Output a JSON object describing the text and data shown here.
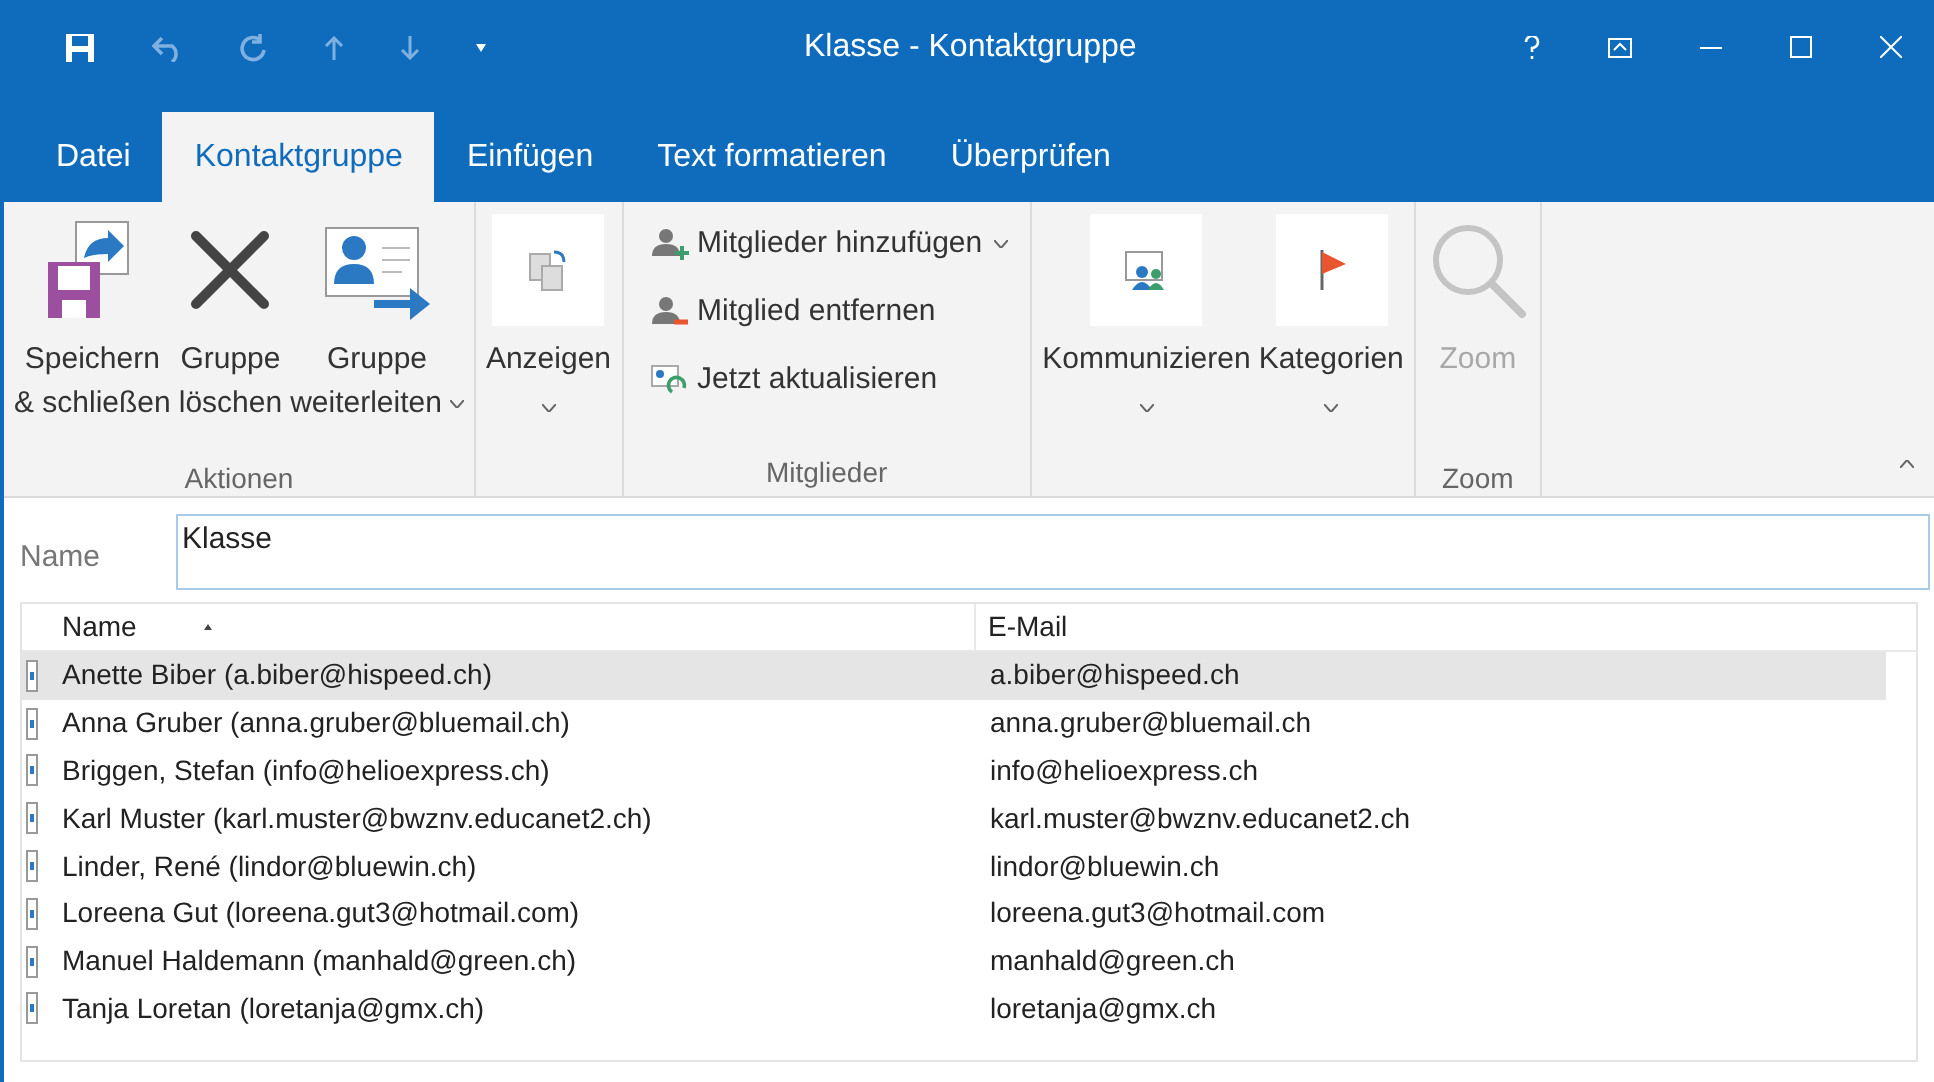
{
  "window": {
    "title": "Klasse - Kontaktgruppe"
  },
  "ribbon_tabs": [
    {
      "label": "Datei",
      "selected": false
    },
    {
      "label": "Kontaktgruppe",
      "selected": true
    },
    {
      "label": "Einfügen",
      "selected": false
    },
    {
      "label": "Text formatieren",
      "selected": false
    },
    {
      "label": "Überprüfen",
      "selected": false
    }
  ],
  "ribbon_groups": [
    {
      "label": "Aktionen",
      "items": [
        {
          "kind": "large",
          "lines": [
            "Speichern",
            "& schließen"
          ],
          "dropdown": false,
          "disabled": false
        },
        {
          "kind": "large",
          "lines": [
            "Gruppe",
            "löschen"
          ],
          "dropdown": false,
          "disabled": false
        },
        {
          "kind": "large",
          "lines": [
            "Gruppe",
            "weiterleiten"
          ],
          "dropdown": true,
          "disabled": false
        }
      ]
    },
    {
      "items": [
        {
          "kind": "large",
          "lines": [
            "Anzeigen"
          ],
          "dropdown": true,
          "disabled": false
        }
      ]
    },
    {
      "label": "Mitglieder",
      "items": [
        {
          "kind": "small",
          "lines": [
            "Mitglieder hinzufügen"
          ],
          "dropdown": true,
          "disabled": false
        },
        {
          "kind": "small",
          "lines": [
            "Mitglied entfernen"
          ],
          "dropdown": false,
          "disabled": false
        },
        {
          "kind": "small",
          "lines": [
            "Jetzt aktualisieren"
          ],
          "dropdown": false,
          "disabled": false
        }
      ]
    },
    {
      "items": [
        {
          "kind": "large",
          "lines": [
            "Kommunizieren"
          ],
          "dropdown": true,
          "disabled": false
        },
        {
          "kind": "large",
          "lines": [
            "Kategorien"
          ],
          "dropdown": true,
          "disabled": false
        }
      ]
    },
    {
      "label": "Zoom",
      "items": [
        {
          "kind": "large",
          "lines": [
            "Zoom"
          ],
          "dropdown": false,
          "disabled": true
        }
      ]
    }
  ],
  "name_field": {
    "label": "Name",
    "value": "Klasse"
  },
  "table": {
    "columns": [
      "Name",
      "E-Mail"
    ],
    "rows": [
      {
        "name": "Anette Biber (a.biber@hispeed.ch)",
        "email": "a.biber@hispeed.ch",
        "selected": true
      },
      {
        "name": "Anna Gruber (anna.gruber@bluemail.ch)",
        "email": "anna.gruber@bluemail.ch",
        "selected": false
      },
      {
        "name": "Briggen, Stefan (info@helioexpress.ch)",
        "email": "info@helioexpress.ch",
        "selected": false
      },
      {
        "name": "Karl Muster (karl.muster@bwznv.educanet2.ch)",
        "email": "karl.muster@bwznv.educanet2.ch",
        "selected": false
      },
      {
        "name": "Linder, René (lindor@bluewin.ch)",
        "email": "lindor@bluewin.ch",
        "selected": false
      },
      {
        "name": "Loreena Gut (loreena.gut3@hotmail.com)",
        "email": "loreena.gut3@hotmail.com",
        "selected": false
      },
      {
        "name": "Manuel Haldemann (manhald@green.ch)",
        "email": "manhald@green.ch",
        "selected": false
      },
      {
        "name": "Tanja Loretan (loretanja@gmx.ch)",
        "email": "loretanja@gmx.ch",
        "selected": false
      }
    ]
  }
}
